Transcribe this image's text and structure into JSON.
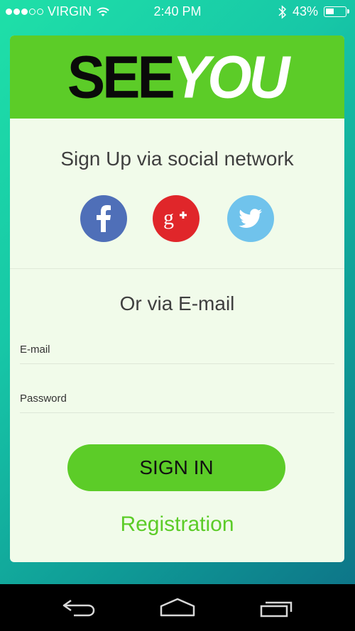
{
  "status_bar": {
    "carrier": "VIRGIN",
    "time": "2:40 PM",
    "battery_percent": "43%",
    "battery_level": 0.43,
    "signal_bars_filled": 3,
    "signal_bars_total": 5,
    "icons": [
      "wifi-icon",
      "bluetooth-icon",
      "battery-icon"
    ]
  },
  "logo": {
    "part1": "SEE",
    "part2": "YOU"
  },
  "social": {
    "title": "Sign Up via social network",
    "buttons": [
      {
        "name": "facebook",
        "icon": "facebook-icon",
        "color": "#4f6fb8"
      },
      {
        "name": "google-plus",
        "icon": "google-plus-icon",
        "color": "#e0262a"
      },
      {
        "name": "twitter",
        "icon": "twitter-icon",
        "color": "#70c3ec"
      }
    ]
  },
  "email_section": {
    "title": "Or via E-mail",
    "email_label": "E-mail",
    "password_label": "Password",
    "email_value": "",
    "password_value": ""
  },
  "actions": {
    "sign_in": "SIGN IN",
    "registration": "Registration"
  },
  "colors": {
    "accent": "#5ccc28",
    "card_bg": "#f1fbea"
  },
  "nav_bar": {
    "icons": [
      "back-icon",
      "home-icon",
      "recent-apps-icon"
    ]
  }
}
